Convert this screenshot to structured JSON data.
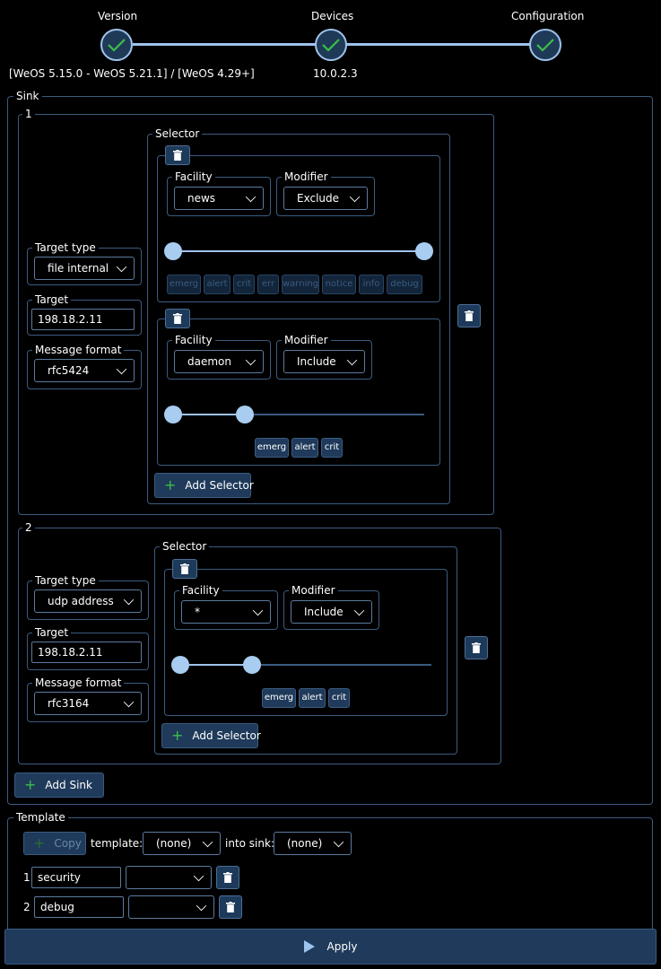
{
  "stepper": {
    "steps": [
      {
        "label": "Version",
        "sub": "[WeOS 5.15.0 - WeOS 5.21.1] / [WeOS 4.29+]",
        "done": true
      },
      {
        "label": "Devices",
        "sub": "10.0.2.3",
        "done": true
      },
      {
        "label": "Configuration",
        "sub": "",
        "done": true
      }
    ]
  },
  "sink_section": {
    "legend": "Sink",
    "add_sink_label": "Add Sink"
  },
  "sinks": [
    {
      "number": "1",
      "target_type_label": "Target type",
      "target_type": "file internal",
      "target_label": "Target",
      "target": "198.18.2.11",
      "format_label": "Message format",
      "format": "rfc5424",
      "selector_legend": "Selector",
      "add_selector_label": "Add Selector",
      "selectors": [
        {
          "facility_label": "Facility",
          "facility": "news",
          "modifier_label": "Modifier",
          "modifier": "Exclude",
          "range": [
            0,
            7
          ],
          "levels": [
            "emerg",
            "alert",
            "crit",
            "err",
            "warning",
            "notice",
            "info",
            "debug"
          ]
        },
        {
          "facility_label": "Facility",
          "facility": "daemon",
          "modifier_label": "Modifier",
          "modifier": "Include",
          "range": [
            0,
            2
          ],
          "levels": [
            "emerg",
            "alert",
            "crit"
          ]
        }
      ]
    },
    {
      "number": "2",
      "target_type_label": "Target type",
      "target_type": "udp address",
      "target_label": "Target",
      "target": "198.18.2.11",
      "format_label": "Message format",
      "format": "rfc3164",
      "selector_legend": "Selector",
      "add_selector_label": "Add Selector",
      "selectors": [
        {
          "facility_label": "Facility",
          "facility": "*",
          "modifier_label": "Modifier",
          "modifier": "Include",
          "range": [
            0,
            2
          ],
          "levels": [
            "emerg",
            "alert",
            "crit"
          ]
        }
      ]
    }
  ],
  "template": {
    "legend": "Template",
    "copy_label": "Copy",
    "template_label": "template:",
    "template_value": "(none)",
    "into_sink_label": "into sink:",
    "into_sink_value": "(none)",
    "rows": [
      {
        "number": "1",
        "name": "security",
        "select": ""
      },
      {
        "number": "2",
        "name": "debug",
        "select": ""
      }
    ]
  },
  "apply_label": "Apply",
  "colors": {
    "accent": "#9ec3ec",
    "border": "#3b5b80",
    "button": "#1f3a5a",
    "success": "#3bbf4a"
  }
}
